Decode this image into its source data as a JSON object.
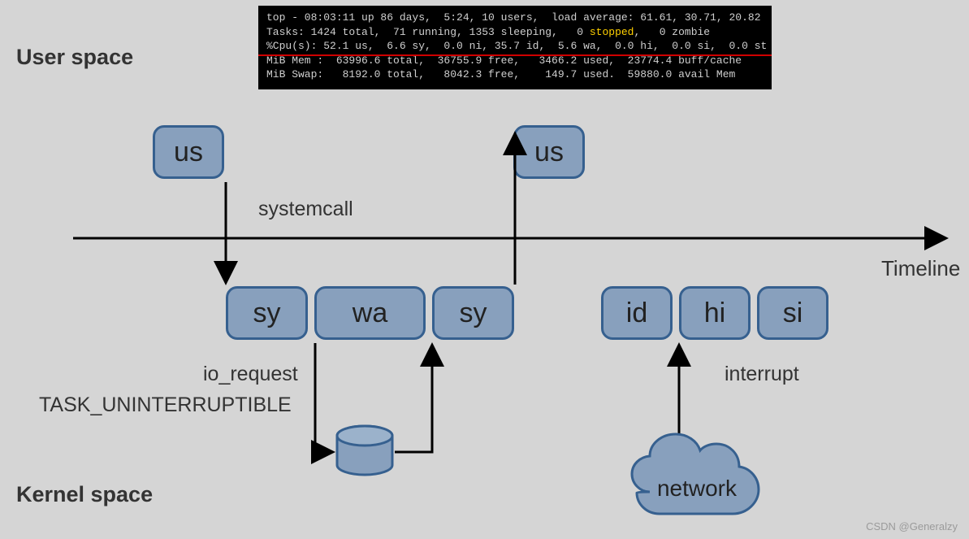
{
  "headings": {
    "user_space": "User space",
    "kernel_space": "Kernel space"
  },
  "labels": {
    "timeline": "Timeline",
    "systemcall": "systemcall",
    "io_request": "io_request",
    "task_state": "TASK_UNINTERRUPTIBLE",
    "interrupt": "interrupt",
    "network": "network"
  },
  "boxes": {
    "us1": "us",
    "us2": "us",
    "sy1": "sy",
    "wa": "wa",
    "sy2": "sy",
    "id": "id",
    "hi": "hi",
    "si": "si"
  },
  "terminal": {
    "l1a": "top - 08:03:11 up 86 days,  5:24, 10 users,  load average: 61.61, 30.71, 20.82",
    "l2a": "Tasks: 1424 total,  71 running, 1353 sleeping,   0 ",
    "l2b": "stopped",
    "l2c": ",   0 zombie",
    "l3": "%Cpu(s): 52.1 us,  6.6 sy,  0.0 ni, 35.7 id,  5.6 wa,  0.0 hi,  0.0 si,  0.0 st",
    "l4": "MiB Mem :  63996.6 total,  36755.9 free,   3466.2 used,  23774.4 buff/cache",
    "l5": "MiB Swap:   8192.0 total,   8042.3 free,    149.7 used.  59880.0 avail Mem"
  },
  "watermark": "CSDN @Generalzy",
  "chart_data": {
    "type": "diagram",
    "title": "Linux CPU usage states across user/kernel space over time",
    "annotations": [
      "User space",
      "Kernel space",
      "Timeline",
      "systemcall",
      "io_request",
      "TASK_UNINTERRUPTIBLE",
      "interrupt",
      "network"
    ],
    "nodes": [
      {
        "id": "us1",
        "label": "us",
        "layer": "User space"
      },
      {
        "id": "us2",
        "label": "us",
        "layer": "User space"
      },
      {
        "id": "sy1",
        "label": "sy",
        "layer": "Kernel space"
      },
      {
        "id": "wa",
        "label": "wa",
        "layer": "Kernel space"
      },
      {
        "id": "sy2",
        "label": "sy",
        "layer": "Kernel space"
      },
      {
        "id": "id",
        "label": "id",
        "layer": "Kernel space"
      },
      {
        "id": "hi",
        "label": "hi",
        "layer": "Kernel space"
      },
      {
        "id": "si",
        "label": "si",
        "layer": "Kernel space"
      },
      {
        "id": "disk",
        "label": "",
        "shape": "cylinder",
        "layer": "Kernel space"
      },
      {
        "id": "network",
        "label": "network",
        "shape": "cloud",
        "layer": "Kernel space"
      }
    ],
    "edges": [
      {
        "from": "us1",
        "to": "sy1",
        "label": "systemcall"
      },
      {
        "from": "sy1",
        "to": "wa"
      },
      {
        "from": "wa",
        "to": "disk",
        "label": "io_request / TASK_UNINTERRUPTIBLE"
      },
      {
        "from": "disk",
        "to": "sy2"
      },
      {
        "from": "sy2",
        "to": "us2"
      },
      {
        "from": "network",
        "to": "hi",
        "label": "interrupt"
      }
    ],
    "top_output": {
      "uptime": "86 days, 5:24",
      "users": 10,
      "load_average": [
        61.61,
        30.71,
        20.82
      ],
      "tasks": {
        "total": 1424,
        "running": 71,
        "sleeping": 1353,
        "stopped": 0,
        "zombie": 0
      },
      "cpu_pct": {
        "us": 52.1,
        "sy": 6.6,
        "ni": 0.0,
        "id": 35.7,
        "wa": 5.6,
        "hi": 0.0,
        "si": 0.0,
        "st": 0.0
      },
      "mem_mib": {
        "total": 63996.6,
        "free": 36755.9,
        "used": 3466.2,
        "buff_cache": 23774.4
      },
      "swap_mib": {
        "total": 8192.0,
        "free": 8042.3,
        "used": 149.7,
        "avail": 59880.0
      }
    }
  }
}
